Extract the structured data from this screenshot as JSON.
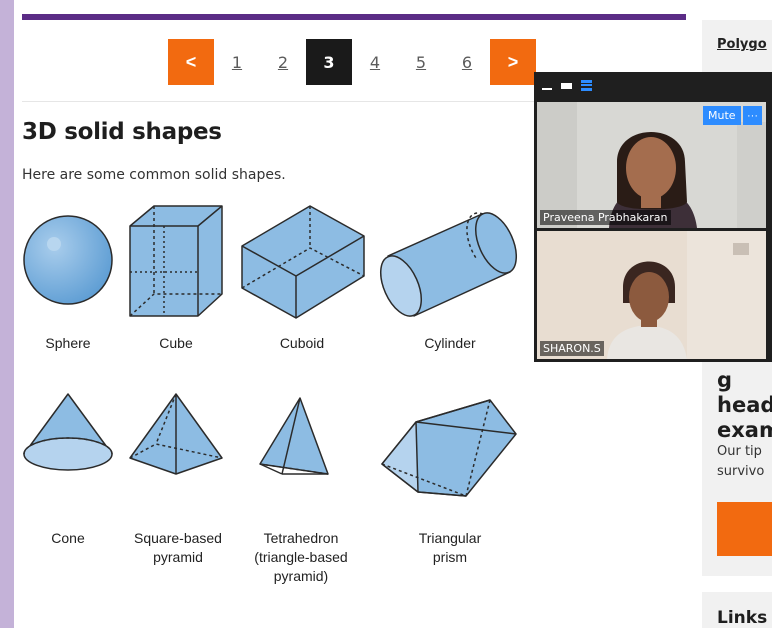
{
  "pagination": {
    "prev": "<",
    "next": ">",
    "pages": [
      "1",
      "2",
      "3",
      "4",
      "5",
      "6"
    ],
    "current": "3"
  },
  "article": {
    "title": "3D solid shapes",
    "intro": "Here are some common solid shapes."
  },
  "shapes": {
    "sphere": "Sphere",
    "cube": "Cube",
    "cuboid": "Cuboid",
    "cylinder": "Cylinder",
    "cone": "Cone",
    "square_pyramid": "Square-based\npyramid",
    "tetrahedron": "Tetrahedron\n(triangle-based\npyramid)",
    "triangular_prism": "Triangular\nprism"
  },
  "sidebar": {
    "top_link": "Polygo",
    "heading": "g\nhead\nexam",
    "text": "Our tip\nsurvivo",
    "links": "Links"
  },
  "video_call": {
    "participant1": "Praveena Prabhakaran",
    "participant2": "SHARON.S",
    "mute_label": "Mute",
    "more_label": "···"
  },
  "colors": {
    "accent_orange": "#f26a10",
    "purple_bar": "#5b2c86",
    "shape_fill": "#7fb3dd",
    "zoom_blue": "#2d8cff"
  }
}
